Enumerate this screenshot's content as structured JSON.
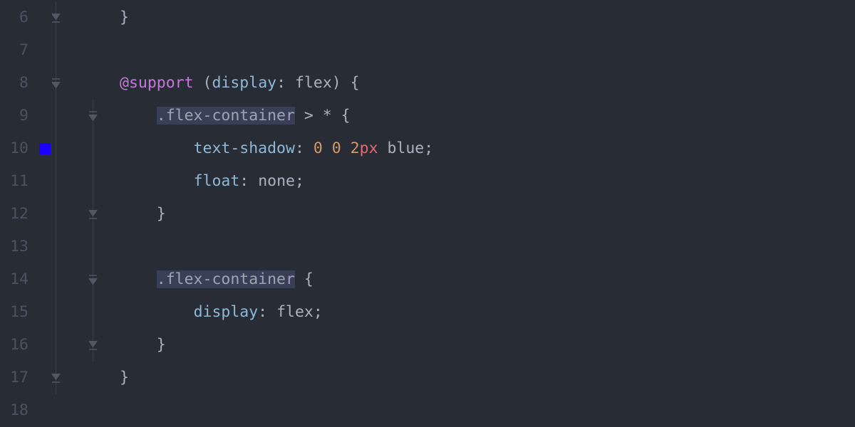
{
  "colors": {
    "background": "#282c34",
    "gutter_text": "#4b5261",
    "default_text": "#abb2bf",
    "keyword": "#c678dd",
    "selector_bg": "#3a3f58",
    "selector_fg": "#9da5b4",
    "property": "#8fb9d6",
    "number": "#d19a66",
    "unit": "#e06c75",
    "breakpoint": "#1c00ff"
  },
  "line_numbers": [
    "6",
    "7",
    "8",
    "9",
    "10",
    "11",
    "12",
    "13",
    "14",
    "15",
    "16",
    "17",
    "18"
  ],
  "breakpoints": {
    "10": true
  },
  "code": {
    "l6": {
      "brace": "}"
    },
    "l8": {
      "kw": "@support",
      "space1": " ",
      "p1": "(",
      "prop": "display",
      "colon": ":",
      "space2": " ",
      "val": "flex",
      "p2": ")",
      "space3": " ",
      "brace": "{"
    },
    "l9": {
      "indent": "    ",
      "sel": ".flex-container",
      "rest": " > * {"
    },
    "l10": {
      "indent": "        ",
      "prop": "text-shadow",
      "colon": ":",
      "s1": " ",
      "n1": "0",
      "s2": " ",
      "n2": "0",
      "s3": " ",
      "n3": "2",
      "unit": "px",
      "s4": " ",
      "val": "blue",
      "semi": ";"
    },
    "l11": {
      "indent": "        ",
      "prop": "float",
      "colon": ":",
      "s1": " ",
      "val": "none",
      "semi": ";"
    },
    "l12": {
      "indent": "    ",
      "brace": "}"
    },
    "l14": {
      "indent": "    ",
      "sel": ".flex-container",
      "rest": " {"
    },
    "l15": {
      "indent": "        ",
      "prop": "display",
      "colon": ":",
      "s1": " ",
      "val": "flex",
      "semi": ";"
    },
    "l16": {
      "indent": "    ",
      "brace": "}"
    },
    "l17": {
      "brace": "}"
    }
  }
}
